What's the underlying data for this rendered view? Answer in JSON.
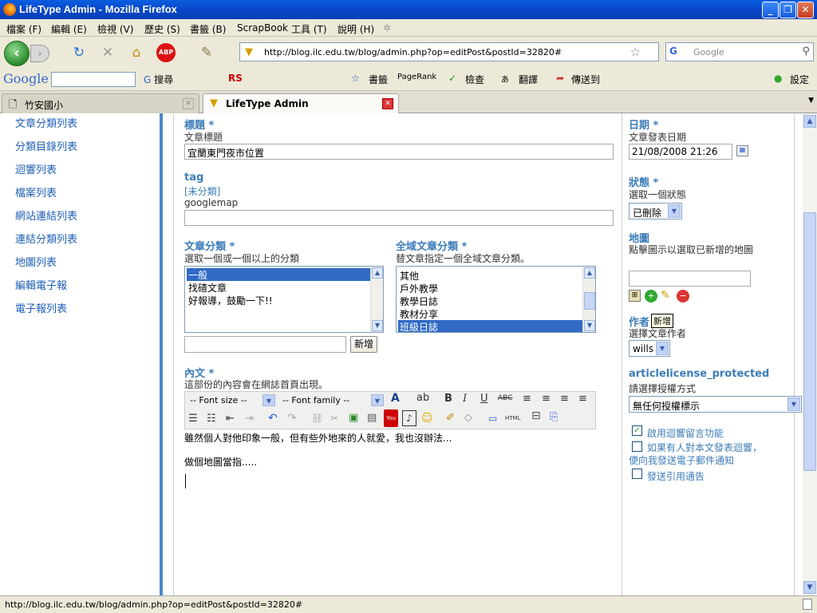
{
  "window": {
    "title": "LifeType Admin - Mozilla Firefox"
  },
  "menu": [
    "檔案 (F)",
    "編輯 (E)",
    "檢視 (V)",
    "歷史 (S)",
    "書籤 (B)",
    "ScrapBook",
    "工具 (T)",
    "說明 (H)"
  ],
  "nav": {
    "url": "http://blog.ilc.edu.tw/blog/admin.php?op=editPost&postId=32820#",
    "search_placeholder": "Google",
    "search_engine": "G"
  },
  "google_toolbar": {
    "logo": "Google",
    "search_label": "搜尋",
    "bookmarks_label": "書籤",
    "pagerank_label": "PageRank",
    "check_label": "檢查",
    "translate_label": "翻譯",
    "sendto_label": "傳送到",
    "settings_label": "設定"
  },
  "tabs": [
    {
      "label": "竹安國小",
      "active": false
    },
    {
      "label": "LifeType Admin",
      "active": true
    }
  ],
  "sidebar": {
    "items": [
      "文章分類列表",
      "分類目錄列表",
      "迴響列表",
      "檔案列表",
      "網站連結列表",
      "連結分類列表",
      "地圖列表",
      "編輯電子報",
      "電子報列表"
    ]
  },
  "form": {
    "title_heading": "標題 *",
    "title_sub": "文章標題",
    "title_value": "宜蘭東門夜市位置",
    "tag_heading": "tag",
    "tag_link": "[未分類]",
    "tag_value": "googlemap",
    "category_heading": "文章分類 *",
    "category_sub": "選取一個或一個以上的分類",
    "categories": [
      "一般",
      "找碴文章",
      "好報導，鼓勵一下!!"
    ],
    "category_selected": "一般",
    "global_heading": "全域文章分類 *",
    "global_sub": "替文章指定一個全域文章分類。",
    "global_categories": [
      "其他",
      "戶外教學",
      "教學日誌",
      "教材分享",
      "班級日誌"
    ],
    "global_selected": "班級日誌",
    "add_button": "新增",
    "content_heading": "內文 *",
    "content_sub": "這部份的內容會在網誌首頁出現。",
    "font_size_select": "-- Font size --",
    "font_family_select": "-- Font family --",
    "content_lines": [
      "雖然個人對他印象一般，但有些外地來的人就愛，我也沒辦法...",
      "做個地圖當指....."
    ]
  },
  "right": {
    "date_heading": "日期 *",
    "date_sub": "文章發表日期",
    "date_value": "21/08/2008 21:26",
    "status_heading": "狀態 *",
    "status_sub": "選取一個狀態",
    "status_value": "已刪除",
    "map_heading": "地圖",
    "map_sub": "點擊圖示以選取已新增的地圖",
    "author_heading": "作者",
    "author_tooltip": "新增",
    "author_sub": "選擇文章作者",
    "author_value": "wills",
    "license_heading": "articlelicense_protected",
    "license_sub": "請選擇授權方式",
    "license_value": "無任何授權標示",
    "opt_comments": "啟用迴響留言功能",
    "opt_comments_checked": true,
    "opt_notify": "如果有人對本文發表迴響，便向我發送電子郵件通知",
    "opt_notify_checked": false,
    "opt_trackback": "發送引用通告",
    "opt_trackback_checked": false
  },
  "status": {
    "text": "http://blog.ilc.edu.tw/blog/admin.php?op=editPost&postId=32820#"
  }
}
